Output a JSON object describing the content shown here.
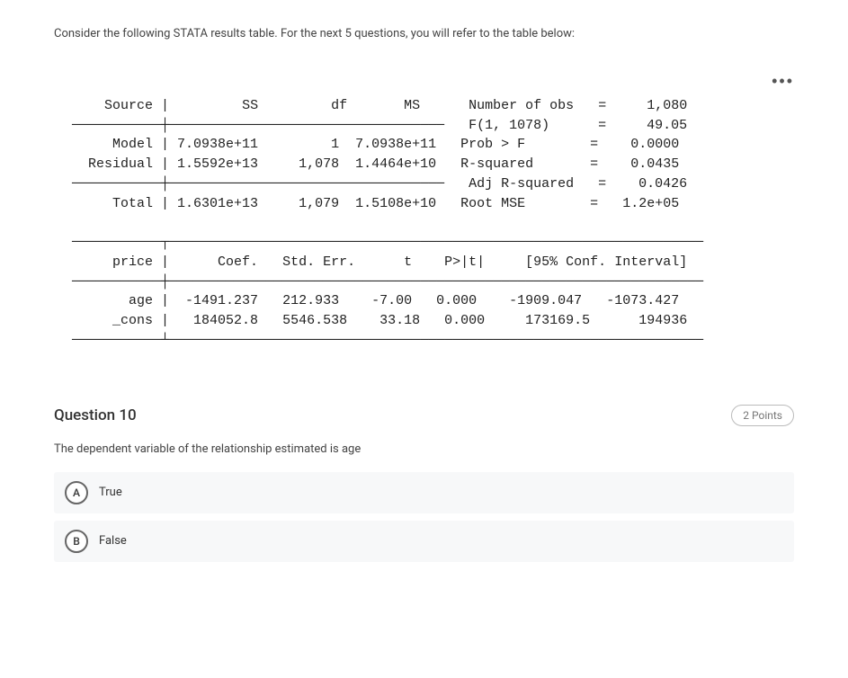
{
  "intro": "Consider the following STATA results table. For the next 5 questions, you will refer to the table below:",
  "stata": {
    "header": {
      "source": "Source",
      "ss": "SS",
      "df": "df",
      "ms": "MS"
    },
    "rows": {
      "model": {
        "label": "Model",
        "ss": "7.0938e+11",
        "df": "1",
        "ms": "7.0938e+11"
      },
      "residual": {
        "label": "Residual",
        "ss": "1.5592e+13",
        "df": "1,078",
        "ms": "1.4464e+10"
      },
      "total": {
        "label": "Total",
        "ss": "1.6301e+13",
        "df": "1,079",
        "ms": "1.5108e+10"
      }
    },
    "stats": {
      "nobs": {
        "label": "Number of obs",
        "eq": "=",
        "val": "1,080"
      },
      "f": {
        "label": "F(1, 1078)",
        "eq": "=",
        "val": "49.05"
      },
      "probf": {
        "label": "Prob > F",
        "eq": "=",
        "val": "0.0000"
      },
      "r2": {
        "label": "R-squared",
        "eq": "=",
        "val": "0.0435"
      },
      "ar2": {
        "label": "Adj R-squared",
        "eq": "=",
        "val": "0.0426"
      },
      "rmse": {
        "label": "Root MSE",
        "eq": "=",
        "val": "1.2e+05"
      }
    },
    "coef_header": {
      "depvar": "price",
      "coef": "Coef.",
      "se": "Std. Err.",
      "t": "t",
      "p": "P>|t|",
      "ci": "[95% Conf. Interval]"
    },
    "coef_rows": {
      "age": {
        "label": "age",
        "coef": "-1491.237",
        "se": "212.933",
        "t": "-7.00",
        "p": "0.000",
        "cil": "-1909.047",
        "cih": "-1073.427"
      },
      "cons": {
        "label": "_cons",
        "coef": "184052.8",
        "se": "5546.538",
        "t": "33.18",
        "p": "0.000",
        "cil": "173169.5",
        "cih": "194936"
      }
    }
  },
  "question": {
    "title": "Question 10",
    "points": "2 Points",
    "text": "The dependent variable of the relationship estimated is age",
    "options": {
      "a": {
        "mark": "A",
        "label": "True"
      },
      "b": {
        "mark": "B",
        "label": "False"
      }
    }
  },
  "chart_data": {
    "type": "table",
    "title": "STATA regression output",
    "anova": [
      {
        "source": "Model",
        "SS": 709380000000.0,
        "df": 1,
        "MS": 709380000000.0
      },
      {
        "source": "Residual",
        "SS": 15592000000000.0,
        "df": 1078,
        "MS": 14464000000.0
      },
      {
        "source": "Total",
        "SS": 16301000000000.0,
        "df": 1079,
        "MS": 15108000000.0
      }
    ],
    "model_stats": {
      "Number of obs": 1080,
      "F(1, 1078)": 49.05,
      "Prob > F": 0.0,
      "R-squared": 0.0435,
      "Adj R-squared": 0.0426,
      "Root MSE": 120000.0
    },
    "dependent_variable": "price",
    "coefficients": [
      {
        "var": "age",
        "Coef": -1491.237,
        "StdErr": 212.933,
        "t": -7.0,
        "P>|t|": 0.0,
        "CI95_low": -1909.047,
        "CI95_high": -1073.427
      },
      {
        "var": "_cons",
        "Coef": 184052.8,
        "StdErr": 5546.538,
        "t": 33.18,
        "P>|t|": 0.0,
        "CI95_low": 173169.5,
        "CI95_high": 194936
      }
    ]
  }
}
